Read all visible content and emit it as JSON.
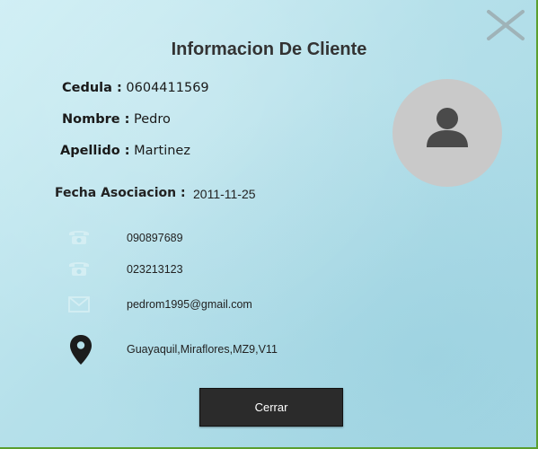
{
  "dialog": {
    "title": "Informacion De Cliente",
    "close_icon": "close-x-icon"
  },
  "client": {
    "cedula_label": "Cedula :",
    "cedula_value": "0604411569",
    "nombre_label": "Nombre :",
    "nombre_value": "Pedro",
    "apellido_label": "Apellido :",
    "apellido_value": "Martinez",
    "fecha_label": "Fecha Asociacion :",
    "fecha_value": "2011-11-25",
    "avatar_icon": "user-avatar-icon"
  },
  "contacts": [
    {
      "icon": "phone-icon",
      "value": "090897689"
    },
    {
      "icon": "phone-icon",
      "value": "023213123"
    },
    {
      "icon": "email-icon",
      "value": "pedrom1995@gmail.com"
    },
    {
      "icon": "location-pin-icon",
      "value": "Guayaquil,Miraflores,MZ9,V11"
    }
  ],
  "actions": {
    "close_button_label": "Cerrar"
  },
  "colors": {
    "background": "#b5e0ea",
    "button": "#2b2b2b",
    "avatar": "#c9c9c9",
    "border_accent": "#5a9e2e"
  }
}
